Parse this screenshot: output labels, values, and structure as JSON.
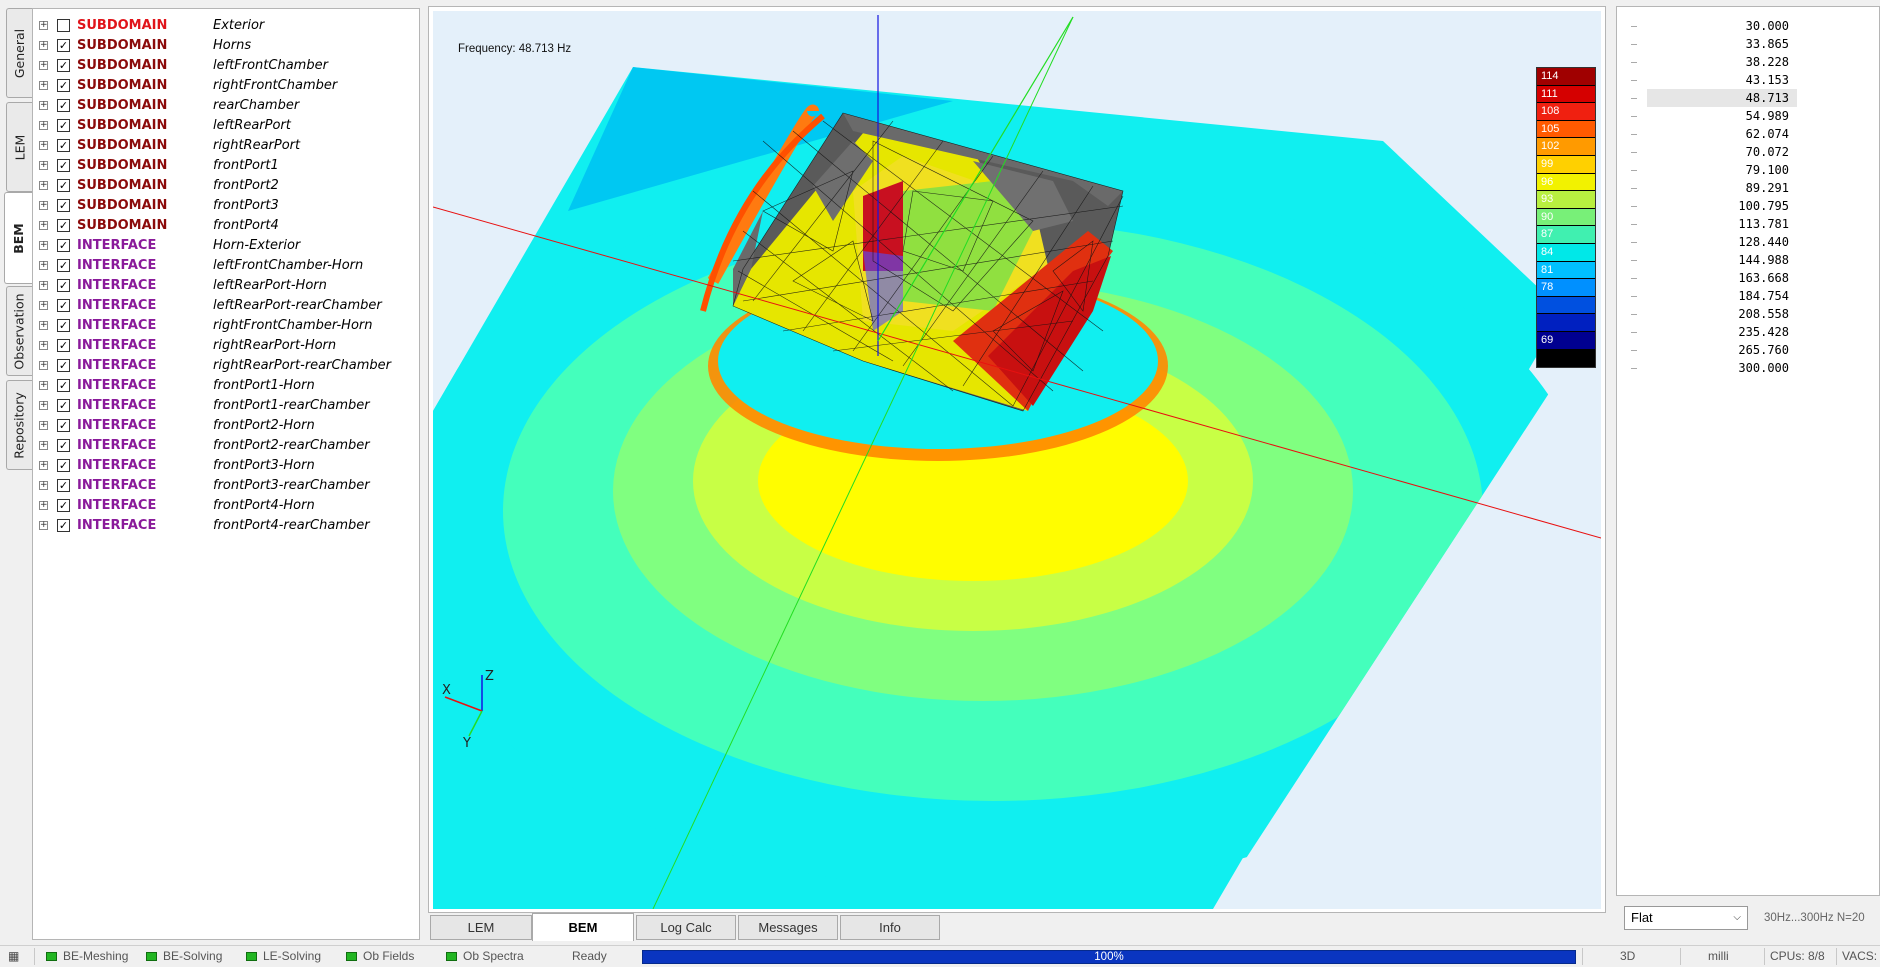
{
  "left_tabs": [
    "General",
    "LEM",
    "BEM",
    "Observation",
    "Repository"
  ],
  "tree": [
    {
      "type": "SUBDOMAIN",
      "name": "Exterior",
      "checked": false,
      "color": "#e0141a"
    },
    {
      "type": "SUBDOMAIN",
      "name": "Horns",
      "checked": true,
      "color": "#8b0a0a"
    },
    {
      "type": "SUBDOMAIN",
      "name": "leftFrontChamber",
      "checked": true,
      "color": "#8b0a0a"
    },
    {
      "type": "SUBDOMAIN",
      "name": "rightFrontChamber",
      "checked": true,
      "color": "#8b0a0a"
    },
    {
      "type": "SUBDOMAIN",
      "name": "rearChamber",
      "checked": true,
      "color": "#8b0a0a"
    },
    {
      "type": "SUBDOMAIN",
      "name": "leftRearPort",
      "checked": true,
      "color": "#8b0a0a"
    },
    {
      "type": "SUBDOMAIN",
      "name": "rightRearPort",
      "checked": true,
      "color": "#8b0a0a"
    },
    {
      "type": "SUBDOMAIN",
      "name": "frontPort1",
      "checked": true,
      "color": "#8b0a0a"
    },
    {
      "type": "SUBDOMAIN",
      "name": "frontPort2",
      "checked": true,
      "color": "#8b0a0a"
    },
    {
      "type": "SUBDOMAIN",
      "name": "frontPort3",
      "checked": true,
      "color": "#8b0a0a"
    },
    {
      "type": "SUBDOMAIN",
      "name": "frontPort4",
      "checked": true,
      "color": "#8b0a0a"
    },
    {
      "type": "INTERFACE",
      "name": "Horn-Exterior",
      "checked": true,
      "color": "#8a1a9a"
    },
    {
      "type": "INTERFACE",
      "name": "leftFrontChamber-Horn",
      "checked": true,
      "color": "#8a1a9a"
    },
    {
      "type": "INTERFACE",
      "name": "leftRearPort-Horn",
      "checked": true,
      "color": "#8a1a9a"
    },
    {
      "type": "INTERFACE",
      "name": "leftRearPort-rearChamber",
      "checked": true,
      "color": "#8a1a9a"
    },
    {
      "type": "INTERFACE",
      "name": "rightFrontChamber-Horn",
      "checked": true,
      "color": "#8a1a9a"
    },
    {
      "type": "INTERFACE",
      "name": "rightRearPort-Horn",
      "checked": true,
      "color": "#8a1a9a"
    },
    {
      "type": "INTERFACE",
      "name": "rightRearPort-rearChamber",
      "checked": true,
      "color": "#8a1a9a"
    },
    {
      "type": "INTERFACE",
      "name": "frontPort1-Horn",
      "checked": true,
      "color": "#8a1a9a"
    },
    {
      "type": "INTERFACE",
      "name": "frontPort1-rearChamber",
      "checked": true,
      "color": "#8a1a9a"
    },
    {
      "type": "INTERFACE",
      "name": "frontPort2-Horn",
      "checked": true,
      "color": "#8a1a9a"
    },
    {
      "type": "INTERFACE",
      "name": "frontPort2-rearChamber",
      "checked": true,
      "color": "#8a1a9a"
    },
    {
      "type": "INTERFACE",
      "name": "frontPort3-Horn",
      "checked": true,
      "color": "#8a1a9a"
    },
    {
      "type": "INTERFACE",
      "name": "frontPort3-rearChamber",
      "checked": true,
      "color": "#8a1a9a"
    },
    {
      "type": "INTERFACE",
      "name": "frontPort4-Horn",
      "checked": true,
      "color": "#8a1a9a"
    },
    {
      "type": "INTERFACE",
      "name": "frontPort4-rearChamber",
      "checked": true,
      "color": "#8a1a9a"
    }
  ],
  "viewport": {
    "frequency_label": "Frequency: 48.713 Hz",
    "axis_labels": {
      "x": "X",
      "y": "Y",
      "z": "Z"
    },
    "colorbar": [
      {
        "label": "114",
        "color": "#a00000"
      },
      {
        "label": "111",
        "color": "#d50000"
      },
      {
        "label": "108",
        "color": "#f02010"
      },
      {
        "label": "105",
        "color": "#ff5a00"
      },
      {
        "label": "102",
        "color": "#ff9a00"
      },
      {
        "label": "99",
        "color": "#ffd000"
      },
      {
        "label": "96",
        "color": "#f2f200"
      },
      {
        "label": "93",
        "color": "#b8f040"
      },
      {
        "label": "90",
        "color": "#78f078"
      },
      {
        "label": "87",
        "color": "#40f0b0"
      },
      {
        "label": "84",
        "color": "#00e8e8"
      },
      {
        "label": "81",
        "color": "#00c0ff"
      },
      {
        "label": "78",
        "color": "#0090ff"
      },
      {
        "label": "",
        "color": "#0050e0"
      },
      {
        "label": "",
        "color": "#0020c0"
      },
      {
        "label": "69",
        "color": "#000090"
      },
      {
        "label": "",
        "color": "#000000"
      }
    ]
  },
  "bottom_tabs": [
    "LEM",
    "BEM",
    "Log Calc",
    "Messages",
    "Info"
  ],
  "active_bottom_tab": "BEM",
  "frequencies": [
    "30.000",
    "33.865",
    "38.228",
    "43.153",
    "48.713",
    "54.989",
    "62.074",
    "70.072",
    "79.100",
    "89.291",
    "100.795",
    "113.781",
    "128.440",
    "144.988",
    "163.668",
    "184.754",
    "208.558",
    "235.428",
    "265.760",
    "300.000"
  ],
  "selected_frequency": "48.713",
  "right_bottom": {
    "select_value": "Flat",
    "info": "30Hz...300Hz  N=20"
  },
  "status": {
    "items": [
      "BE-Meshing",
      "BE-Solving",
      "LE-Solving",
      "Ob Fields",
      "Ob Spectra"
    ],
    "state": "Ready",
    "progress": "100%",
    "progress_value": 1.0,
    "view": "3D",
    "units": "milli",
    "cpus": "CPUs: 8/8",
    "app": "VACS:"
  }
}
